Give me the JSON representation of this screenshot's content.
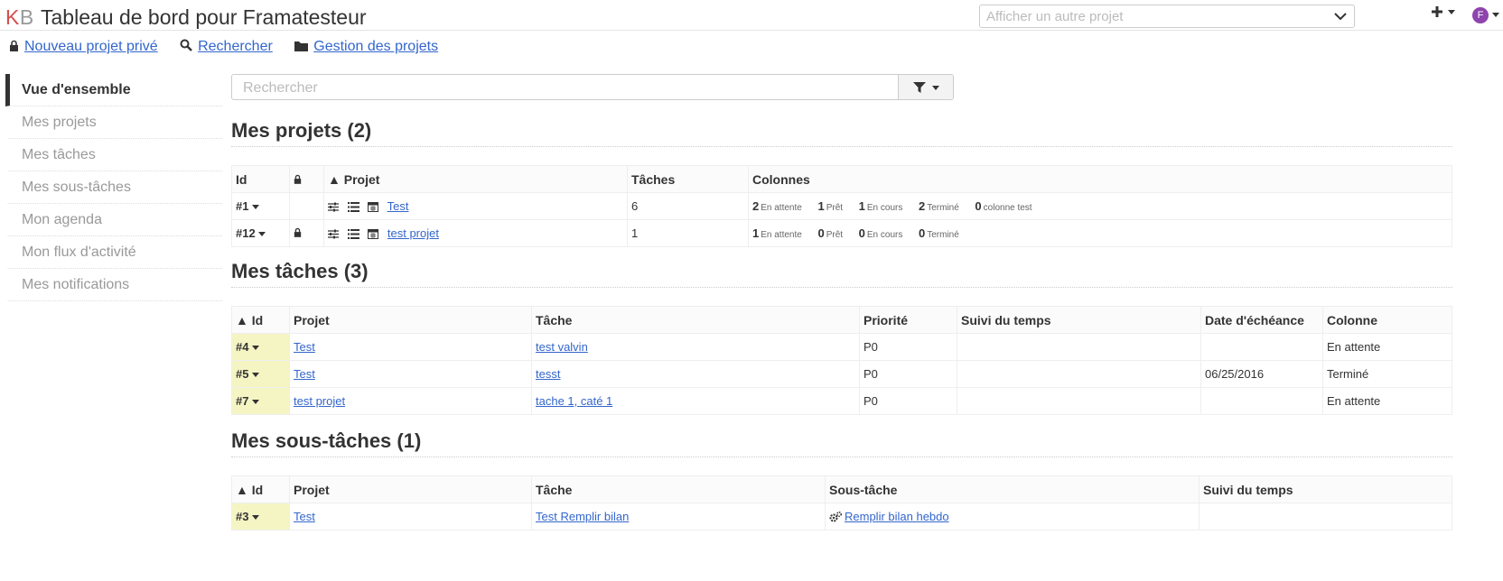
{
  "header": {
    "logo_k": "K",
    "logo_b": "B",
    "title": "Tableau de bord pour Framatesteur",
    "project_select_placeholder": "Afficher un autre projet",
    "avatar_letter": "F"
  },
  "actions": {
    "new_private_project": "Nouveau projet privé",
    "search": "Rechercher",
    "manage_projects": "Gestion des projets"
  },
  "sidebar": {
    "items": [
      {
        "label": "Vue d'ensemble",
        "active": true
      },
      {
        "label": "Mes projets"
      },
      {
        "label": "Mes tâches"
      },
      {
        "label": "Mes sous-tâches"
      },
      {
        "label": "Mon agenda"
      },
      {
        "label": "Mon flux d'activité"
      },
      {
        "label": "Mes notifications"
      }
    ]
  },
  "search": {
    "placeholder": "Rechercher"
  },
  "projects": {
    "heading": "Mes projets (2)",
    "headers": {
      "id": "Id",
      "project": "▲ Projet",
      "tasks": "Tâches",
      "columns": "Colonnes"
    },
    "rows": [
      {
        "id": "#1",
        "locked": false,
        "name": "Test",
        "tasks": "6",
        "columns": [
          [
            "2",
            "En attente"
          ],
          [
            "1",
            "Prêt"
          ],
          [
            "1",
            "En cours"
          ],
          [
            "2",
            "Terminé"
          ],
          [
            "0",
            "colonne test"
          ]
        ]
      },
      {
        "id": "#12",
        "locked": true,
        "name": "test projet",
        "tasks": "1",
        "columns": [
          [
            "1",
            "En attente"
          ],
          [
            "0",
            "Prêt"
          ],
          [
            "0",
            "En cours"
          ],
          [
            "0",
            "Terminé"
          ]
        ]
      }
    ]
  },
  "tasks": {
    "heading": "Mes tâches (3)",
    "headers": {
      "id": "▲ Id",
      "project": "Projet",
      "task": "Tâche",
      "priority": "Priorité",
      "time": "Suivi du temps",
      "due": "Date d'échéance",
      "column": "Colonne"
    },
    "rows": [
      {
        "id": "#4",
        "project": "Test",
        "task": "test valvin",
        "priority": "P0",
        "time": "",
        "due": "",
        "column": "En attente"
      },
      {
        "id": "#5",
        "project": "Test",
        "task": "tesst",
        "priority": "P0",
        "time": "",
        "due": "06/25/2016",
        "column": "Terminé"
      },
      {
        "id": "#7",
        "project": "test projet",
        "task": "tache 1, caté 1",
        "priority": "P0",
        "time": "",
        "due": "",
        "column": "En attente"
      }
    ]
  },
  "subtasks": {
    "heading": "Mes sous-tâches (1)",
    "headers": {
      "id": "▲ Id",
      "project": "Projet",
      "task": "Tâche",
      "subtask": "Sous-tâche",
      "time": "Suivi du temps"
    },
    "rows": [
      {
        "id": "#3",
        "project": "Test",
        "task": "Test Remplir bilan",
        "subtask": "Remplir bilan hebdo",
        "time": ""
      }
    ]
  },
  "colors": {
    "accent_link": "#3366cc",
    "id_highlight": "#f5f5c4",
    "avatar": "#8e44ad",
    "logo_k": "#d64e4e"
  }
}
